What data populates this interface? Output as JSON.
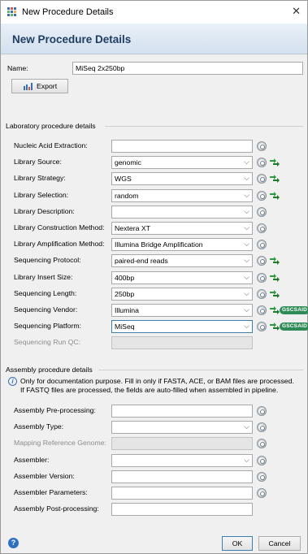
{
  "window": {
    "title": "New Procedure Details",
    "close_glyph": "✕"
  },
  "banner": {
    "heading": "New Procedure Details"
  },
  "name": {
    "label": "Name:",
    "value": "MiSeq 2x250bp"
  },
  "export": {
    "label": "Export",
    "icon": "chart-export-icon"
  },
  "lab_section": {
    "title": "Laboratory procedure details"
  },
  "lab_fields": [
    {
      "label": "Nucleic Acid Extraction:",
      "value": "",
      "dropdown": false,
      "disabled": false,
      "green": false,
      "badge": ""
    },
    {
      "label": "Library Source:",
      "value": "genomic",
      "dropdown": true,
      "disabled": false,
      "green": true,
      "badge": ""
    },
    {
      "label": "Library Strategy:",
      "value": "WGS",
      "dropdown": true,
      "disabled": false,
      "green": true,
      "badge": ""
    },
    {
      "label": "Library Selection:",
      "value": "random",
      "dropdown": true,
      "disabled": false,
      "green": true,
      "badge": ""
    },
    {
      "label": "Library Description:",
      "value": "",
      "dropdown": true,
      "disabled": false,
      "green": false,
      "badge": ""
    },
    {
      "label": "Library Construction Method:",
      "value": "Nextera XT",
      "dropdown": true,
      "disabled": false,
      "green": false,
      "badge": ""
    },
    {
      "label": "Library Amplification Method:",
      "value": "Illumina Bridge Amplification",
      "dropdown": true,
      "disabled": false,
      "green": false,
      "badge": ""
    },
    {
      "label": "Sequencing Protocol:",
      "value": "paired-end reads",
      "dropdown": true,
      "disabled": false,
      "green": true,
      "badge": ""
    },
    {
      "label": "Library Insert Size:",
      "value": "400bp",
      "dropdown": true,
      "disabled": false,
      "green": true,
      "badge": ""
    },
    {
      "label": "Sequencing Length:",
      "value": "250bp",
      "dropdown": true,
      "disabled": false,
      "green": true,
      "badge": ""
    },
    {
      "label": "Sequencing Vendor:",
      "value": "Illumina",
      "dropdown": true,
      "disabled": false,
      "green": true,
      "badge": "GSCSAID"
    },
    {
      "label": "Sequencing Platform:",
      "value": "MiSeq",
      "dropdown": true,
      "disabled": false,
      "green": true,
      "badge": "GSCSAID",
      "focused": true
    },
    {
      "label": "Sequencing Run QC:",
      "value": "",
      "dropdown": false,
      "disabled": true,
      "green": false,
      "badge": "",
      "noicon": true
    }
  ],
  "assembly_section": {
    "title": "Assembly procedure details",
    "info_line1": "Only for documentation purpose. Fill in only if FASTA, ACE, or BAM files are processed.",
    "info_line2": "If FASTQ files are processed, the fields are auto-filled when assembled in pipeline."
  },
  "assembly_fields": [
    {
      "label": "Assembly Pre-processing:",
      "value": "",
      "dropdown": false,
      "disabled": false
    },
    {
      "label": "Assembly Type:",
      "value": "",
      "dropdown": true,
      "disabled": false
    },
    {
      "label": "Mapping Reference Genome:",
      "value": "",
      "dropdown": false,
      "disabled": true
    },
    {
      "label": "Assembler:",
      "value": "",
      "dropdown": true,
      "disabled": false
    },
    {
      "label": "Assembler Version:",
      "value": "",
      "dropdown": false,
      "disabled": false
    },
    {
      "label": "Assembler Parameters:",
      "value": "",
      "dropdown": false,
      "disabled": false
    },
    {
      "label": "Assembly Post-processing:",
      "value": "",
      "dropdown": false,
      "disabled": false,
      "noicon": true
    }
  ],
  "footer": {
    "ok": "OK",
    "cancel": "Cancel",
    "help": "?"
  },
  "colors": {
    "banner_text": "#1f3d63",
    "accent": "#3c7fb1",
    "badge": "#2e8b57"
  }
}
